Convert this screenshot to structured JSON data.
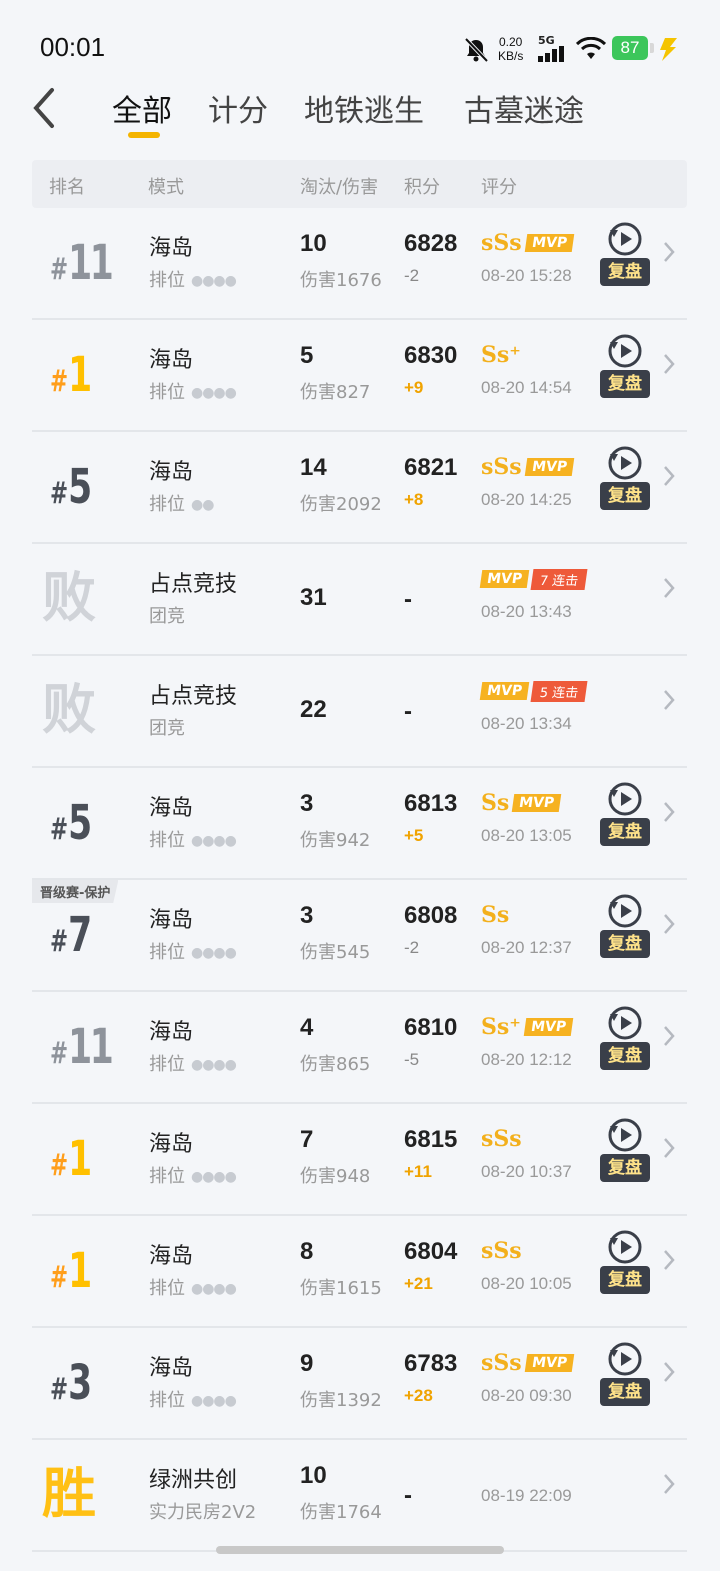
{
  "status_bar": {
    "time": "00:01",
    "net_speed": "0.20",
    "net_unit": "KB/s",
    "net_type": "5G",
    "battery": "87"
  },
  "tabs": [
    "全部",
    "计分",
    "地铁逃生",
    "古墓迷途"
  ],
  "active_tab": 0,
  "header": {
    "rank": "排名",
    "mode": "模式",
    "kills": "淘汰/伤害",
    "score": "积分",
    "rating": "评分"
  },
  "replay_label": "复盘",
  "rows": [
    {
      "rank": "11",
      "rank_style": "grey",
      "mode": "海岛",
      "sub": "排位",
      "squad_dots": "●●●●",
      "kills": "10",
      "damage": "伤害1676",
      "score": "6828",
      "delta": "-2",
      "delta_up": false,
      "grade": "sSs",
      "mvp": "MVP",
      "date": "08-20 15:28",
      "replay": true
    },
    {
      "rank": "1",
      "rank_style": "gold",
      "mode": "海岛",
      "sub": "排位",
      "squad_dots": "●●●●",
      "kills": "5",
      "damage": "伤害827",
      "score": "6830",
      "delta": "+9",
      "delta_up": true,
      "grade": "Ss⁺",
      "mvp": "",
      "date": "08-20 14:54",
      "replay": true
    },
    {
      "rank": "5",
      "rank_style": "dark",
      "mode": "海岛",
      "sub": "排位",
      "squad_dots": "●●",
      "kills": "14",
      "damage": "伤害2092",
      "score": "6821",
      "delta": "+8",
      "delta_up": true,
      "grade": "sSs",
      "mvp": "MVP",
      "date": "08-20 14:25",
      "replay": true
    },
    {
      "big": "败",
      "mode": "占点竞技",
      "sub": "团竞",
      "kills": "31",
      "score": "-",
      "mvp": "MVP",
      "streak": "7 连击",
      "date": "08-20 13:43",
      "replay": false
    },
    {
      "big": "败",
      "mode": "占点竞技",
      "sub": "团竞",
      "kills": "22",
      "score": "-",
      "mvp": "MVP",
      "streak": "5 连击",
      "date": "08-20 13:34",
      "replay": false
    },
    {
      "rank": "5",
      "rank_style": "dark",
      "mode": "海岛",
      "sub": "排位",
      "squad_dots": "●●●●",
      "kills": "3",
      "damage": "伤害942",
      "score": "6813",
      "delta": "+5",
      "delta_up": true,
      "grade": "Ss",
      "mvp": "MVP",
      "date": "08-20 13:05",
      "replay": true
    },
    {
      "rank": "7",
      "rank_style": "dark",
      "promo": "晋级赛-保护",
      "mode": "海岛",
      "sub": "排位",
      "squad_dots": "●●●●",
      "kills": "3",
      "damage": "伤害545",
      "score": "6808",
      "delta": "-2",
      "delta_up": false,
      "grade": "Ss",
      "mvp": "",
      "date": "08-20 12:37",
      "replay": true
    },
    {
      "rank": "11",
      "rank_style": "grey",
      "mode": "海岛",
      "sub": "排位",
      "squad_dots": "●●●●",
      "kills": "4",
      "damage": "伤害865",
      "score": "6810",
      "delta": "-5",
      "delta_up": false,
      "grade": "Ss⁺",
      "mvp": "MVP",
      "date": "08-20 12:12",
      "replay": true
    },
    {
      "rank": "1",
      "rank_style": "gold",
      "mode": "海岛",
      "sub": "排位",
      "squad_dots": "●●●●",
      "kills": "7",
      "damage": "伤害948",
      "score": "6815",
      "delta": "+11",
      "delta_up": true,
      "grade": "sSs",
      "mvp": "",
      "date": "08-20 10:37",
      "replay": true
    },
    {
      "rank": "1",
      "rank_style": "gold",
      "mode": "海岛",
      "sub": "排位",
      "squad_dots": "●●●●",
      "kills": "8",
      "damage": "伤害1615",
      "score": "6804",
      "delta": "+21",
      "delta_up": true,
      "grade": "sSs",
      "mvp": "",
      "date": "08-20 10:05",
      "replay": true
    },
    {
      "rank": "3",
      "rank_style": "dark",
      "mode": "海岛",
      "sub": "排位",
      "squad_dots": "●●●●",
      "kills": "9",
      "damage": "伤害1392",
      "score": "6783",
      "delta": "+28",
      "delta_up": true,
      "grade": "sSs",
      "mvp": "MVP",
      "date": "08-20 09:30",
      "replay": true
    },
    {
      "big": "胜",
      "big_win": true,
      "mode": "绿洲共创",
      "sub": "实力民房2V2",
      "kills": "10",
      "damage": "伤害1764",
      "score": "-",
      "date": "08-19 22:09",
      "replay": false
    }
  ]
}
